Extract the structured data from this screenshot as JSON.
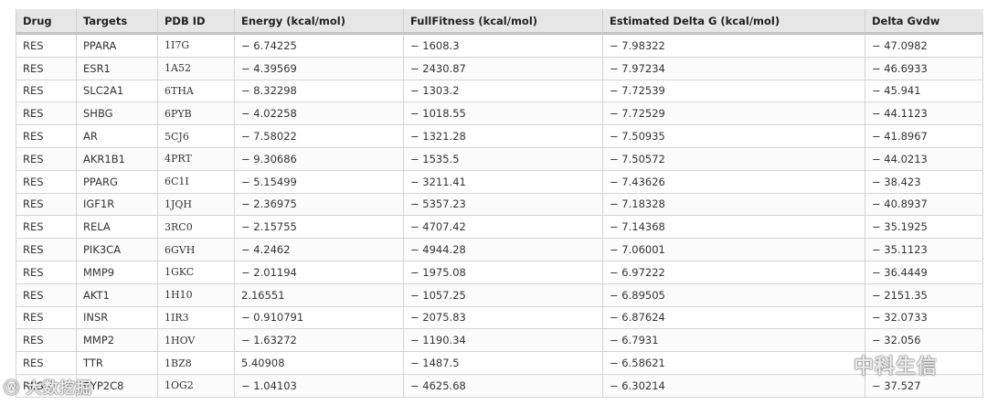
{
  "table": {
    "headers": [
      "Drug",
      "Targets",
      "PDB ID",
      "Energy (kcal/mol)",
      "FullFitness (kcal/mol)",
      "Estimated Delta G (kcal/mol)",
      "Delta Gvdw"
    ],
    "rows": [
      [
        "RES",
        "PPARA",
        "1I7G",
        "− 6.74225",
        "− 1608.3",
        "− 7.98322",
        "− 47.0982"
      ],
      [
        "RES",
        "ESR1",
        "1A52",
        "− 4.39569",
        "− 2430.87",
        "− 7.97234",
        "− 46.6933"
      ],
      [
        "RES",
        "SLC2A1",
        "6THA",
        "− 8.32298",
        "− 1303.2",
        "− 7.72539",
        "− 45.941"
      ],
      [
        "RES",
        "SHBG",
        "6PYB",
        "− 4.02258",
        "− 1018.55",
        "− 7.72529",
        "− 44.1123"
      ],
      [
        "RES",
        "AR",
        "5CJ6",
        "− 7.58022",
        "− 1321.28",
        "− 7.50935",
        "− 41.8967"
      ],
      [
        "RES",
        "AKR1B1",
        "4PRT",
        "− 9.30686",
        "− 1535.5",
        "− 7.50572",
        "− 44.0213"
      ],
      [
        "RES",
        "PPARG",
        "6C1I",
        "− 5.15499",
        "− 3211.41",
        "− 7.43626",
        "− 38.423"
      ],
      [
        "RES",
        "IGF1R",
        "1JQH",
        "− 2.36975",
        "− 5357.23",
        "− 7.18328",
        "− 40.8937"
      ],
      [
        "RES",
        "RELA",
        "3RC0",
        "− 2.15755",
        "− 4707.42",
        "− 7.14368",
        "− 35.1925"
      ],
      [
        "RES",
        "PIK3CA",
        "6GVH",
        "− 4.2462",
        "− 4944.28",
        "− 7.06001",
        "− 35.1123"
      ],
      [
        "RES",
        "MMP9",
        "1GKC",
        "− 2.01194",
        "− 1975.08",
        "− 6.97222",
        "− 36.4449"
      ],
      [
        "RES",
        "AKT1",
        "1H10",
        "2.16551",
        "− 1057.25",
        "− 6.89505",
        "− 2151.35"
      ],
      [
        "RES",
        "INSR",
        "1IR3",
        "− 0.910791",
        "− 2075.83",
        "− 6.87624",
        "− 32.0733"
      ],
      [
        "RES",
        "MMP2",
        "1HOV",
        "− 1.63272",
        "− 1190.34",
        "− 6.7931",
        "− 32.056"
      ],
      [
        "RES",
        "TTR",
        "1BZ8",
        "5.40908",
        "− 1487.5",
        "− 6.58621",
        ""
      ],
      [
        "RES",
        "CYP2C8",
        "1OG2",
        "− 1.04103",
        "− 4625.68",
        "− 6.30214",
        "− 37.527"
      ]
    ]
  },
  "watermarks": {
    "left_text": "大数挖掘",
    "right_text": "中科生信",
    "left_icon": "weibo-icon",
    "right_icon": "wechat-icon"
  }
}
